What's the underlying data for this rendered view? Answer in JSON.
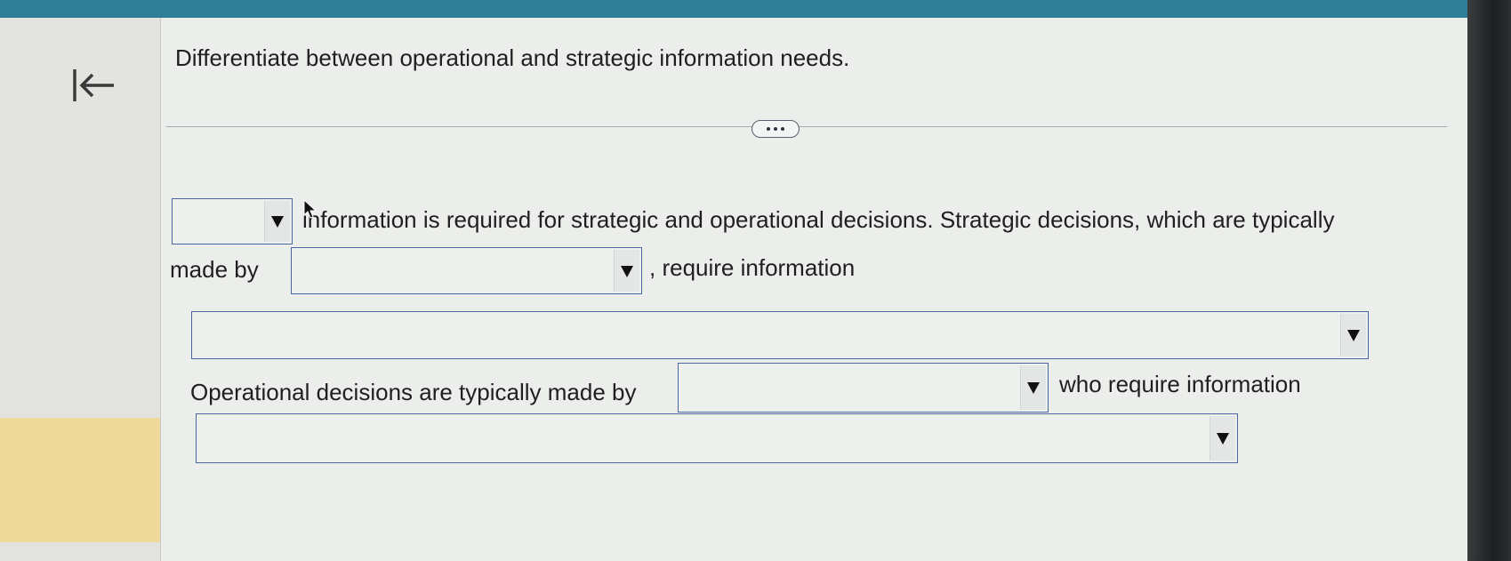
{
  "navigation": {
    "back_icon": "collapse-left-arrow-icon"
  },
  "question": {
    "text": "Differentiate between operational and strategic information needs."
  },
  "divider": {
    "more_icon": "ellipsis-icon"
  },
  "sentence": {
    "part1": "information is required for strategic and operational decisions. Strategic decisions, which are typically",
    "part2": "made by",
    "part3": ", require information",
    "part4": "Operational decisions are typically made by",
    "part5": "who require information"
  },
  "dropdowns": {
    "dropdown1": {
      "value": "",
      "arrow_icon": "dropdown-triangle-icon"
    },
    "dropdown2": {
      "value": "",
      "arrow_icon": "dropdown-triangle-icon"
    },
    "dropdown3": {
      "value": "",
      "arrow_icon": "dropdown-triangle-icon"
    },
    "dropdown4": {
      "value": "",
      "arrow_icon": "dropdown-triangle-icon"
    },
    "dropdown5": {
      "value": "",
      "arrow_icon": "dropdown-triangle-icon"
    }
  },
  "colors": {
    "top_bar": "#2f7d96",
    "dropdown_border": "#4a67a3",
    "left_highlight": "#efd99b"
  }
}
